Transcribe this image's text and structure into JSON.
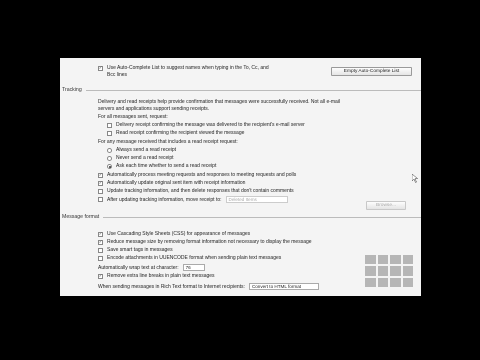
{
  "top": {
    "autocomplete_label": "Use Auto-Complete List to suggest names when typing in the To, Cc, and",
    "autocomplete_label2": "Bcc lines",
    "empty_autocomplete_button": "Empty Auto-Complete List"
  },
  "tracking": {
    "heading": "Tracking",
    "description1": "Delivery and read receipts help provide confirmation that messages were successfully received. Not all e-mail",
    "description2": "servers and applications support sending receipts.",
    "for_all_label": "For all messages sent, request:",
    "delivery_receipt": "Delivery receipt confirming the message was delivered to the recipient's e-mail server",
    "read_receipt": "Read receipt confirming the recipient viewed the message",
    "for_any_label": "For any message received that includes a read receipt request:",
    "always_send": "Always send a read receipt",
    "never_send": "Never send a read receipt",
    "ask_each_time": "Ask each time whether to send a read receipt",
    "auto_process": "Automatically process meeting requests and responses to meeting requests and polls",
    "auto_update": "Automatically update original sent item with receipt information",
    "update_tracking": "Update tracking information, and then delete responses that don't contain comments",
    "after_updating": "After updating tracking information, move receipt to:",
    "folder_value": "Deleted Items",
    "browse_button": "Browse..."
  },
  "message_format": {
    "heading": "Message format",
    "use_css": "Use Cascading Style Sheets (CSS) for appearance of messages",
    "reduce_size": "Reduce message size by removing format information not necessary to display the message",
    "save_smart_tags": "Save smart tags in messages",
    "encode_attachments": "Encode attachments in UUENCODE format when sending plain text messages",
    "wrap_label": "Automatically wrap text at character:",
    "wrap_value": "76",
    "remove_line_breaks": "Remove extra line breaks in plain text messages",
    "rich_text_label": "When sending messages in Rich Text format to Internet recipients:",
    "rich_text_value": "Convert to HTML format"
  },
  "colors": {
    "background": "#000000",
    "panel": "#f4f4f4"
  }
}
